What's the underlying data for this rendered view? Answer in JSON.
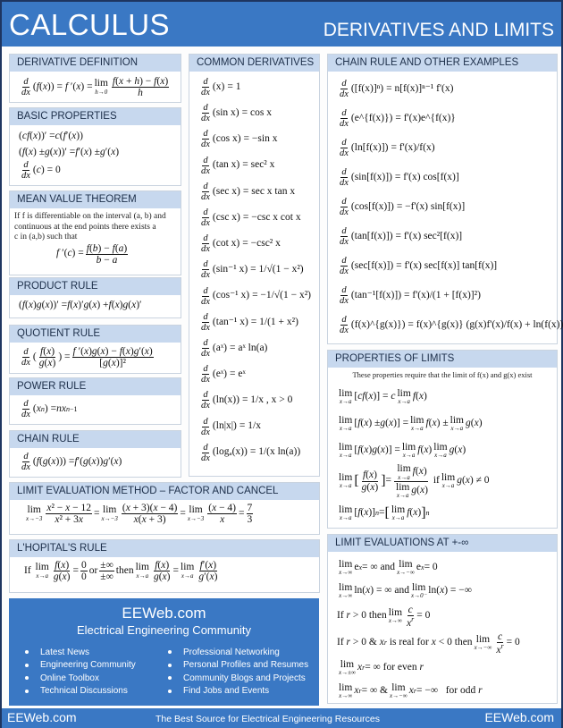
{
  "banner": {
    "title": "CALCULUS",
    "subtitle": "DERIVATIVES AND LIMITS"
  },
  "sections": {
    "derivative_definition": {
      "title": "DERIVATIVE DEFINITION",
      "formula": "d/dx (f(x)) = f'(x) = lim_{h→0} (f(x+h) − f(x))/h"
    },
    "basic_properties": {
      "title": "BASIC PROPERTIES",
      "formulas": [
        "(cf(x))' = c(f'(x))",
        "(f(x) ± g(x))' = f'(x) ± g'(x)",
        "d/dx (c) = 0"
      ]
    },
    "mean_value_theorem": {
      "title": "MEAN VALUE THEOREM",
      "text_line1": "If f is differentiable on the interval (a, b) and",
      "text_line2": "continuous at the end points there exists a",
      "text_line3": "c in (a,b) such that",
      "formula": "f'(c) = (f(b) − f(a))/(b − a)"
    },
    "product_rule": {
      "title": "PRODUCT RULE",
      "formula": "(f(x)g(x))' = f(x)'g(x) + f(x)g(x)'"
    },
    "quotient_rule": {
      "title": "QUOTIENT RULE",
      "formula": "d/dx (f(x)/g(x)) = (f'(x)g(x) − f(x)g'(x))/[g(x)]²"
    },
    "power_rule": {
      "title": "POWER RULE",
      "formula": "d/dx (xⁿ) = nxⁿ⁻¹"
    },
    "chain_rule": {
      "title": "CHAIN RULE",
      "formula": "d/dx (f(g(x))) = f'(g(x))g'(x)"
    },
    "common_derivatives": {
      "title": "COMMON DERIVATIVES",
      "items": [
        {
          "arg": "(x)",
          "result": "= 1"
        },
        {
          "arg": "(sin x)",
          "result": "= cos x"
        },
        {
          "arg": "(cos x)",
          "result": "= −sin x"
        },
        {
          "arg": "(tan x)",
          "result": "= sec² x"
        },
        {
          "arg": "(sec x)",
          "result": "= sec x tan x"
        },
        {
          "arg": "(csc x)",
          "result": "= −csc x cot x"
        },
        {
          "arg": "(cot x)",
          "result": "= −csc² x"
        },
        {
          "arg": "(sin⁻¹ x)",
          "result": "= 1/√(1 − x²)"
        },
        {
          "arg": "(cos⁻¹ x)",
          "result": "= −1/√(1 − x²)"
        },
        {
          "arg": "(tan⁻¹ x)",
          "result": "= 1/(1 + x²)"
        },
        {
          "arg": "(aˣ)",
          "result": "= aˣ ln(a)"
        },
        {
          "arg": "(eˣ)",
          "result": "= eˣ"
        },
        {
          "arg": "(ln(x))",
          "result": "= 1/x , x > 0"
        },
        {
          "arg": "(ln|x|)",
          "result": "= 1/x"
        },
        {
          "arg": "(logₐ(x))",
          "result": "= 1/(x ln(a))"
        }
      ]
    },
    "chain_rule_examples": {
      "title": "CHAIN RULE AND OTHER EXAMPLES",
      "items": [
        {
          "arg": "([f(x)]ⁿ)",
          "result": "= n[f(x)]ⁿ⁻¹ f'(x)"
        },
        {
          "arg": "(e^{f(x)})",
          "result": "= f'(x)e^{f(x)}"
        },
        {
          "arg": "(ln[f(x)])",
          "result": "= f'(x)/f(x)"
        },
        {
          "arg": "(sin[f(x)])",
          "result": "= f'(x) cos[f(x)]"
        },
        {
          "arg": "(cos[f(x)])",
          "result": "= −f'(x) sin[f(x)]"
        },
        {
          "arg": "(tan[f(x)])",
          "result": "= f'(x) sec²[f(x)]"
        },
        {
          "arg": "(sec[f(x)])",
          "result": "= f'(x) sec[f(x)] tan[f(x)]"
        },
        {
          "arg": "(tan⁻¹[f(x)])",
          "result": "= f'(x)/(1 + [f(x)]²)"
        },
        {
          "arg": "(f(x)^{g(x)})",
          "result": "= f(x)^{g(x)} (g(x)f'(x)/f(x) + ln(f(x)) g'(x))"
        }
      ]
    },
    "properties_of_limits": {
      "title": "PROPERTIES OF LIMITS",
      "note": "These properties require that the limit of f(x) and g(x) exist",
      "items": [
        "lim_{x→a}[cf(x)] = c lim_{x→a} f(x)",
        "lim_{x→a}[f(x) ± g(x)] = lim_{x→a} f(x) ± lim_{x→a} g(x)",
        "lim_{x→a}[f(x) g(x)] = lim_{x→a} f(x) lim_{x→a} g(x)",
        "lim_{x→a}[f(x)/g(x)] = lim f(x) / lim g(x) if lim_{x→a} g(x) ≠ 0",
        "lim_{x→a}[f(x)]ⁿ = [lim_{x→a} f(x)]ⁿ"
      ]
    },
    "limit_evaluation_method": {
      "title": "LIMIT EVALUATION METHOD – FACTOR AND CANCEL",
      "formula": "lim_{x→−3} (x² − x − 12)/(x² + 3x) = lim_{x→−3} (x+3)(x−4)/(x(x+3)) = lim_{x→−3} (x−4)/x = 7/3"
    },
    "lhopitals_rule": {
      "title": "L'HOPITAL'S RULE",
      "formula": "If lim_{x→a} f(x)/g(x) = 0/0 or ±∞/±∞ then lim_{x→a} f(x)/g(x) = lim_{x→a} f'(x)/g'(x)"
    },
    "limit_evaluations_infinity": {
      "title": "LIMIT EVALUATIONS AT +-∞",
      "items": [
        "lim_{x→∞} eˣ = ∞ and lim_{x→−∞} eˣ = 0",
        "lim_{x→∞} ln(x) = ∞ and lim_{x→0⁺} ln(x) = −∞",
        "If r > 0 then lim_{x→∞} c/xʳ = 0",
        "If r > 0 & xʳ is real for x < 0 then lim_{x→−∞} c/xʳ = 0",
        "lim_{x→±∞} xʳ = ∞ for even r",
        "lim_{x→∞} xʳ = ∞ & lim_{x→−∞} xʳ = −∞ for odd r"
      ]
    }
  },
  "promo": {
    "brand": "EEWeb.com",
    "subtitle": "Electrical Engineering Community",
    "left_items": [
      "Latest News",
      "Engineering Community",
      "Online Toolbox",
      "Technical Discussions"
    ],
    "right_items": [
      "Professional Networking",
      "Personal Profiles and Resumes",
      "Community Blogs and Projects",
      "Find Jobs and Events"
    ]
  },
  "footer": {
    "left": "EEWeb.com",
    "center": "The Best Source for Electrical Engineering Resources",
    "right": "EEWeb.com"
  },
  "colors": {
    "brand_blue": "#3a78c4",
    "header_band": "#c7d8ee"
  }
}
